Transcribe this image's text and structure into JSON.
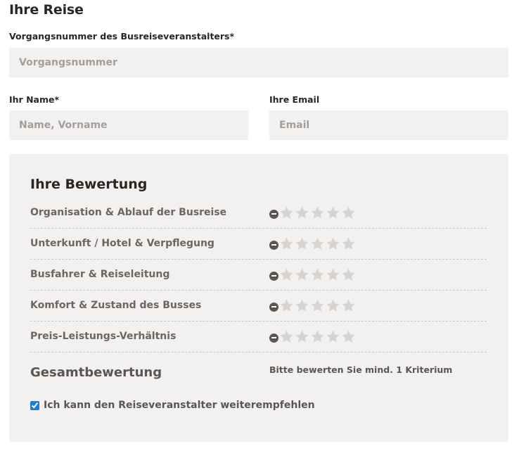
{
  "trip": {
    "title": "Ihre Reise",
    "booking_number_label": "Vorgangsnummer des Busreiseveranstalters*",
    "booking_number_placeholder": "Vorgangsnummer",
    "booking_number_value": "",
    "name_label": "Ihr Name*",
    "name_placeholder": "Name, Vorname",
    "name_value": "",
    "email_label": "Ihre Email",
    "email_placeholder": "Email",
    "email_value": ""
  },
  "rating": {
    "title": "Ihre Bewertung",
    "star_color": "#d6d3d1",
    "clear_icon": "minus-circle-icon",
    "star_icon": "star-icon",
    "criteria": [
      {
        "label": "Organisation & Ablauf der Busreise",
        "stars_selected": 0,
        "stars_max": 5
      },
      {
        "label": "Unterkunft / Hotel & Verpflegung",
        "stars_selected": 0,
        "stars_max": 5
      },
      {
        "label": "Busfahrer & Reiseleitung",
        "stars_selected": 0,
        "stars_max": 5
      },
      {
        "label": "Komfort & Zustand des Busses",
        "stars_selected": 0,
        "stars_max": 5
      },
      {
        "label": "Preis-Leistungs-Verhältnis",
        "stars_selected": 0,
        "stars_max": 5
      }
    ],
    "total_label": "Gesamtbewertung",
    "total_hint": "Bitte bewerten Sie mind. 1 Kriterium",
    "recommend_label": "Ich kann den Reiseveranstalter weiterempfehlen",
    "recommend_checked": true
  }
}
